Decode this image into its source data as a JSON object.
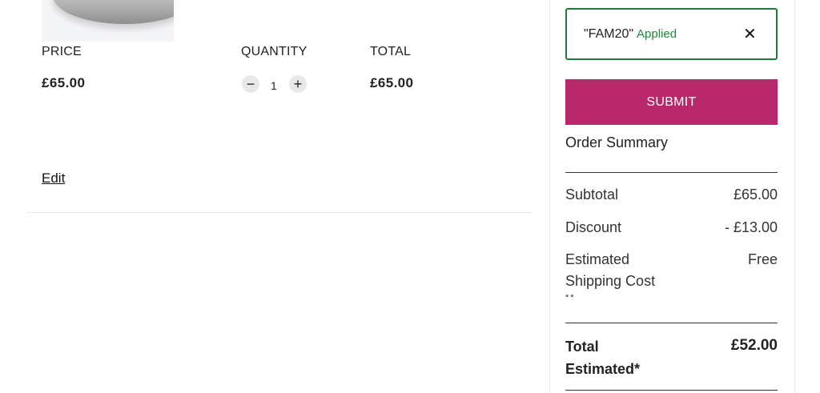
{
  "cart_item": {
    "image_alt": "product image",
    "price_label": "PRICE",
    "quantity_label": "QUANTITY",
    "total_label": "TOTAL",
    "price": "£65.00",
    "quantity": "1",
    "decrease_symbol": "−",
    "increase_symbol": "+",
    "total": "£65.00",
    "edit_label": "Edit"
  },
  "promo": {
    "code": "\"FAM20\"",
    "status": "Applied",
    "remove_symbol": "✕",
    "status_color": "#1e8a3a",
    "border_color": "#1e7a3c"
  },
  "submit_label": "SUBMIT",
  "submit_color": "#b8286a",
  "summary": {
    "title": "Order Summary",
    "subtotal_label": "Subtotal",
    "subtotal_value": "£65.00",
    "discount_label": "Discount",
    "discount_value": "- £13.00",
    "shipping_label_line1": "Estimated",
    "shipping_label_line2": "Shipping Cost",
    "shipping_note": "**",
    "shipping_value": "Free",
    "total_label_line1": "Total",
    "total_label_line2": "Estimated*",
    "total_value": "£52.00"
  }
}
